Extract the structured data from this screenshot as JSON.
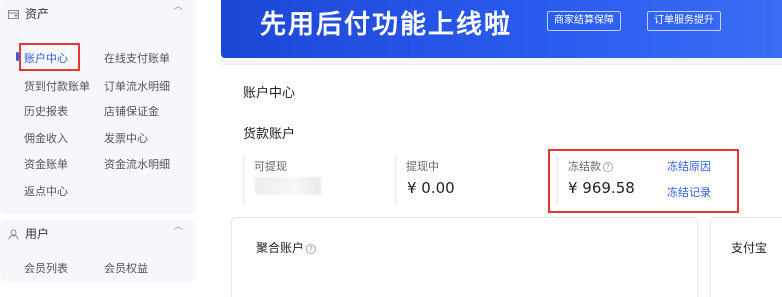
{
  "sidebar": {
    "assets": {
      "title": "资产",
      "items": [
        "账户中心",
        "在线支付账单",
        "货到付款账单",
        "订单流水明细",
        "历史报表",
        "店铺保证金",
        "佣金收入",
        "发票中心",
        "资金账单",
        "资金流水明细",
        "返点中心"
      ]
    },
    "users": {
      "title": "用户",
      "items": [
        "会员列表",
        "会员权益"
      ]
    }
  },
  "banner": {
    "title": "先用后付功能上线啦",
    "tags": [
      "商家结算保障",
      "订单服务提升"
    ]
  },
  "main": {
    "page_title": "账户中心",
    "goods_account": {
      "title": "货款账户",
      "withdrawable_label": "可提现",
      "withdrawing_label": "提现中",
      "withdrawing_value": "¥ 0.00",
      "frozen_label": "冻结款",
      "frozen_value": "¥ 969.58",
      "freeze_reason_link": "冻结原因",
      "freeze_record_link": "冻结记录"
    },
    "aggregate_account": {
      "title": "聚合账户"
    },
    "alipay_account": {
      "title": "支付宝"
    }
  },
  "colors": {
    "accent": "#2f5fe3",
    "highlight_box": "#e53935",
    "banner": "#1c47d6",
    "sidebar_bg": "#f6f7fa"
  }
}
